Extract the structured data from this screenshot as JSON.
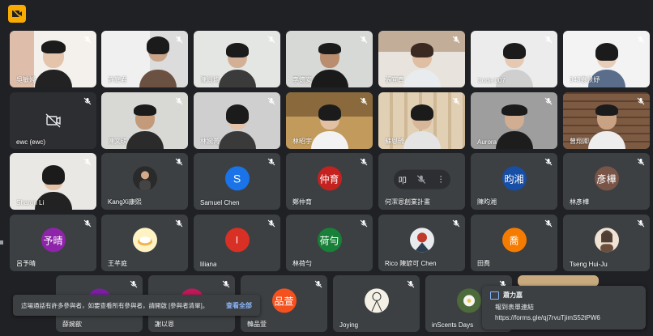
{
  "tiles": [
    {
      "name": "吳敏婷"
    },
    {
      "name": "許庭君"
    },
    {
      "name": "陳尚均"
    },
    {
      "name": "李懷安"
    },
    {
      "name": "張宜真"
    },
    {
      "name": "Coda 007"
    },
    {
      "name": "043袁景妤"
    },
    {
      "name": "ewc (ewc)"
    },
    {
      "name": "陳文琪"
    },
    {
      "name": "林婉菁"
    },
    {
      "name": "林昭宇"
    },
    {
      "name": "蘇恩琦"
    },
    {
      "name": "Aurora"
    },
    {
      "name": "曾翔卿"
    },
    {
      "name": "Sharon Li"
    },
    {
      "name": "KangXi康熙"
    },
    {
      "name": "Samuel Chen",
      "initial": "S"
    },
    {
      "name": "鄭仲育",
      "initial": "仲育"
    },
    {
      "name": "何潔恩創業計畫"
    },
    {
      "name": "陳昀湘",
      "initial": "昀湘"
    },
    {
      "name": "林彥樺",
      "initial": "彥樺"
    },
    {
      "name": "呂予晴",
      "initial": "予晴"
    },
    {
      "name": "王芊庭"
    },
    {
      "name": "liliana",
      "initial": "l"
    },
    {
      "name": "林荷勻",
      "initial": "荷勻"
    },
    {
      "name": "Rico 陳諺可 Chen"
    },
    {
      "name": "田喬",
      "initial": "喬"
    },
    {
      "name": "Tseng Hui-Ju"
    },
    {
      "name": "薛婉歆"
    },
    {
      "name": "謝以恩"
    },
    {
      "name": "韓品萱",
      "initial": "品萱"
    },
    {
      "name": "Joying"
    },
    {
      "name": "inScents Days"
    }
  ],
  "hover_bar": {
    "left_label": "叩",
    "more": "⋮"
  },
  "toast": {
    "message": "這場通話有許多參與者，如要查看所有參與者，請開啟 [參與者清單]。",
    "action": "查看全部"
  },
  "chat": {
    "sender": "蕭力嘉",
    "line1": "報到表單連結",
    "line2": "https://forms.gle/qj7rvuTjimS52tPW6"
  },
  "colors": {
    "background": "#202124",
    "tile": "#3c4043",
    "accent": "#f9ab00",
    "link": "#8ab4f8"
  }
}
